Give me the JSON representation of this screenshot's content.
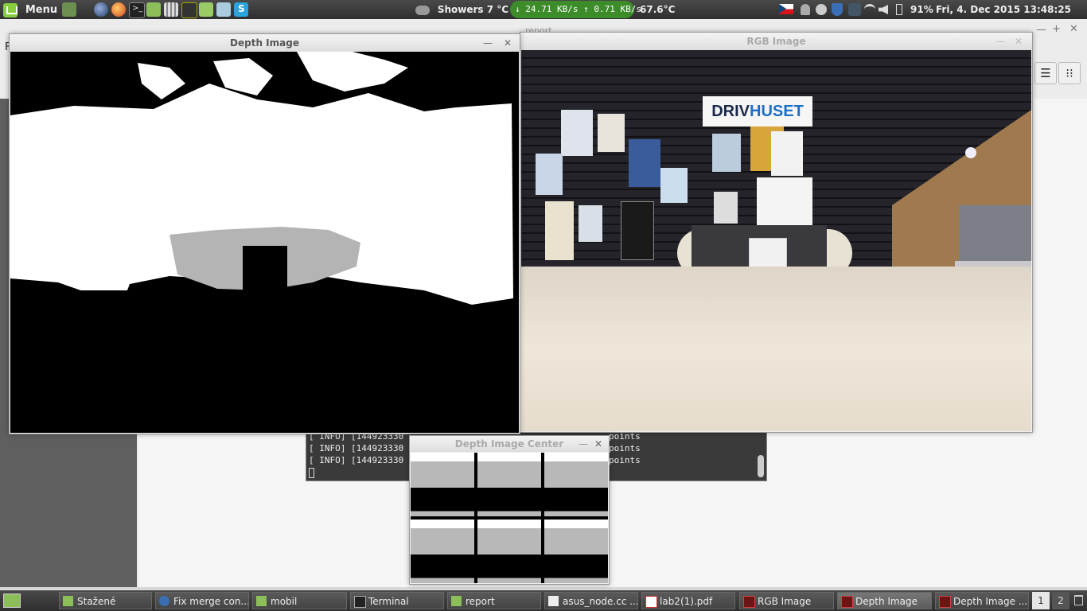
{
  "top_panel": {
    "menu_label": "Menu",
    "weather": "Showers 7 °C",
    "net_down": "↓ 24.71 KB/s",
    "net_up": "↑ 0.71 KB/s",
    "cpu_temp": "67.6°C",
    "battery": "91%",
    "clock": "Fri,  4. Dec 2015 13:48:25"
  },
  "file_manager": {
    "title": "report",
    "menu_letter": "F"
  },
  "windows": {
    "depth_image": {
      "title": "Depth Image"
    },
    "rgb_image": {
      "title": "RGB Image",
      "sign_text": "DRIVHUSET",
      "sign_brand_a": "DRIV",
      "sign_brand_b": "HUSET"
    },
    "depth_center": {
      "title": "Depth Image Center"
    }
  },
  "terminal": {
    "lines": [
      {
        "prefix": "[ INFO] [144923330",
        "suffix": "points"
      },
      {
        "prefix": "[ INFO] [144923330",
        "suffix": "points"
      },
      {
        "prefix": "[ INFO] [144923330",
        "suffix": "points"
      }
    ]
  },
  "taskbar": {
    "items": [
      {
        "label": "Stažené",
        "icon": "folder-icon"
      },
      {
        "label": "Fix merge con...",
        "icon": "browser-icon"
      },
      {
        "label": "mobil",
        "icon": "folder-icon"
      },
      {
        "label": "Terminal",
        "icon": "terminal-icon"
      },
      {
        "label": "report",
        "icon": "folder-icon"
      },
      {
        "label": "asus_node.cc ...",
        "icon": "text-file-icon"
      },
      {
        "label": "lab2(1).pdf",
        "icon": "pdf-icon"
      },
      {
        "label": "RGB Image",
        "icon": "image-window-icon"
      },
      {
        "label": "Depth Image",
        "icon": "image-window-icon"
      },
      {
        "label": "Depth Image ...",
        "icon": "image-window-icon"
      }
    ],
    "workspaces": [
      "1",
      "2"
    ]
  },
  "colors": {
    "panel": "#3a3a3a",
    "net_green": "#3c8c2a",
    "mint_green": "#87cf3e"
  }
}
